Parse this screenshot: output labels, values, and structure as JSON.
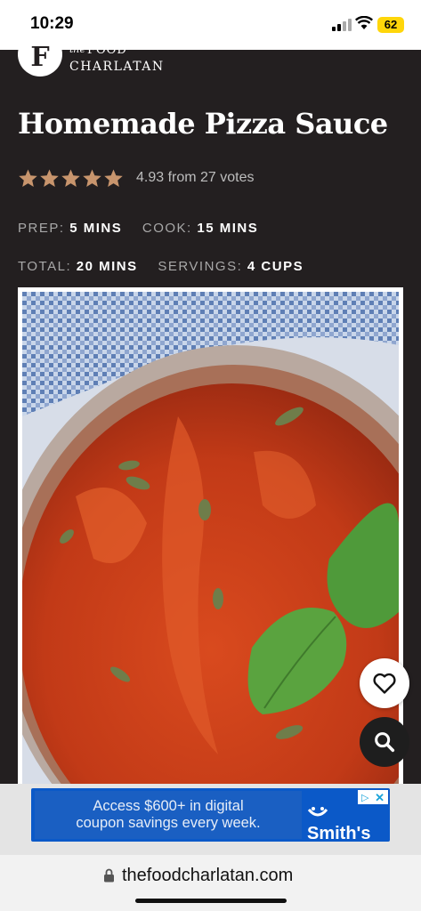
{
  "status": {
    "time": "10:29",
    "battery": "62"
  },
  "brand": {
    "the": "the",
    "food": "FOOD",
    "name": "CHARLATAN",
    "initial": "F"
  },
  "recipe": {
    "title": "Homemade Pizza Sauce",
    "rating_value": 5,
    "rating_max": 5,
    "rating_text": "4.93 from 27 votes",
    "prep_label": "PREP:",
    "prep_value": "5 MINS",
    "cook_label": "COOK:",
    "cook_value": "15 MINS",
    "total_label": "TOTAL:",
    "total_value": "20 MINS",
    "servings_label": "SERVINGS:",
    "servings_value": "4 CUPS"
  },
  "ad": {
    "line1": "Access $600+ in digital",
    "line2": "coupon savings every week.",
    "brand": "Smith's"
  },
  "browser": {
    "url": "thefoodcharlatan.com"
  },
  "icons": {
    "favorite": "heart-icon",
    "search": "search-icon",
    "lock": "lock-icon",
    "star": "star-icon"
  },
  "colors": {
    "background": "#231f20",
    "star": "#c8956d",
    "ad_blue": "#0b59c8"
  }
}
